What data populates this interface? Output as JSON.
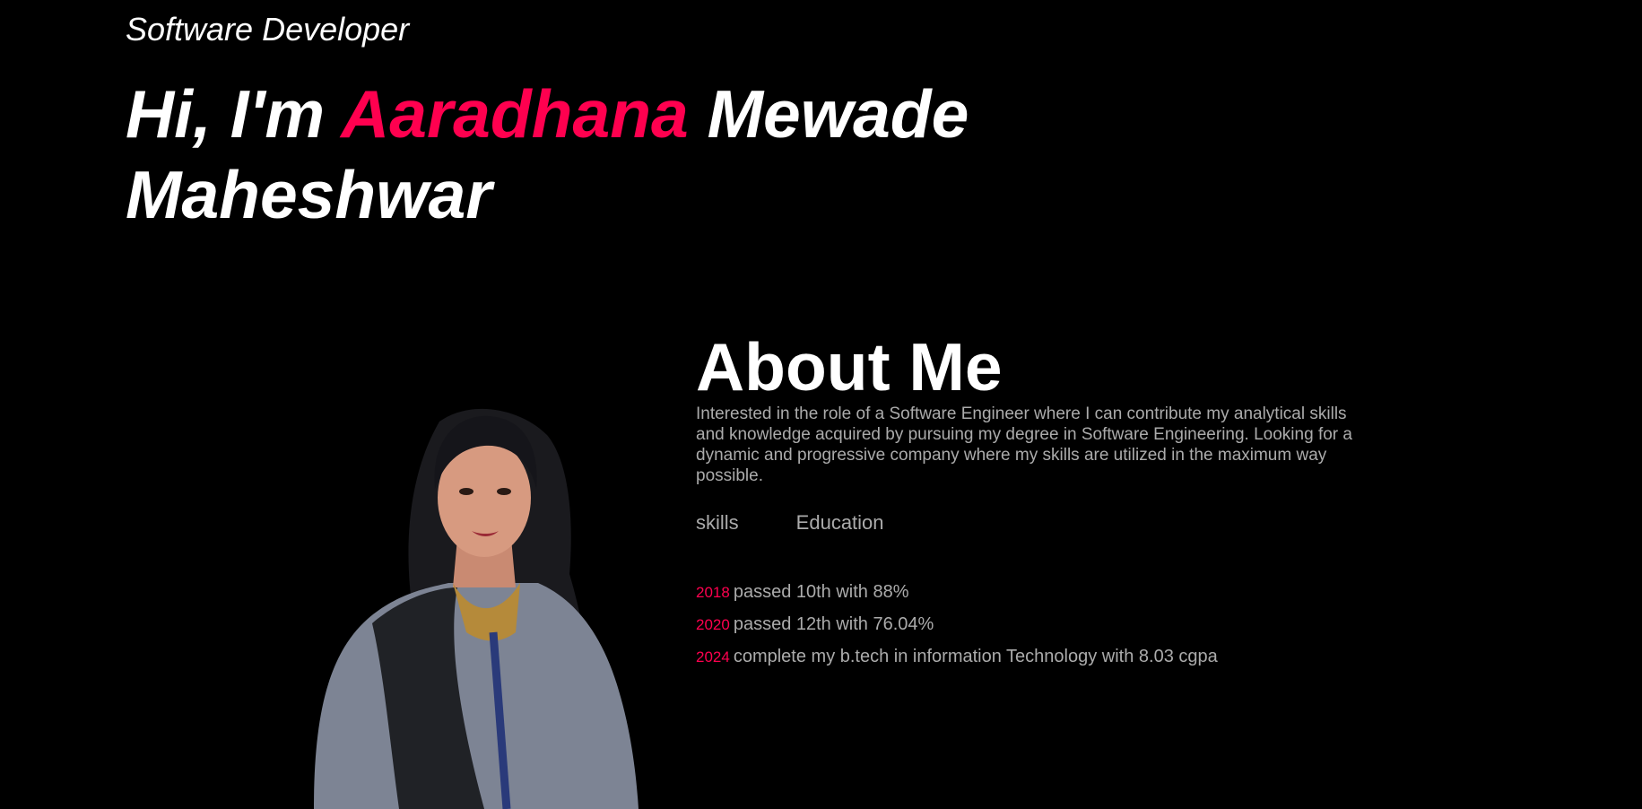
{
  "hero": {
    "subtitle": "Software Developer",
    "greeting": "Hi, I'm ",
    "first_name": "Aaradhana",
    "last_name": " Mewade Maheshwar"
  },
  "about": {
    "title": "About Me",
    "text": "Interested in the role of a Software Engineer where I can contribute my analytical skills and knowledge acquired by pursuing my degree in Software Engineering. Looking for a dynamic and progressive company where my skills are utilized in the maximum way possible.",
    "tabs": [
      {
        "label": "skills"
      },
      {
        "label": "Education"
      }
    ],
    "education": [
      {
        "year": "2018",
        "text": "passed 10th with 88%"
      },
      {
        "year": "2020",
        "text": "passed 12th with 76.04%"
      },
      {
        "year": "2024",
        "text": "complete my b.tech in information Technology with 8.03 cgpa"
      }
    ]
  },
  "colors": {
    "accent": "#ff004f",
    "background": "#000000",
    "muted_text": "#ababab"
  }
}
